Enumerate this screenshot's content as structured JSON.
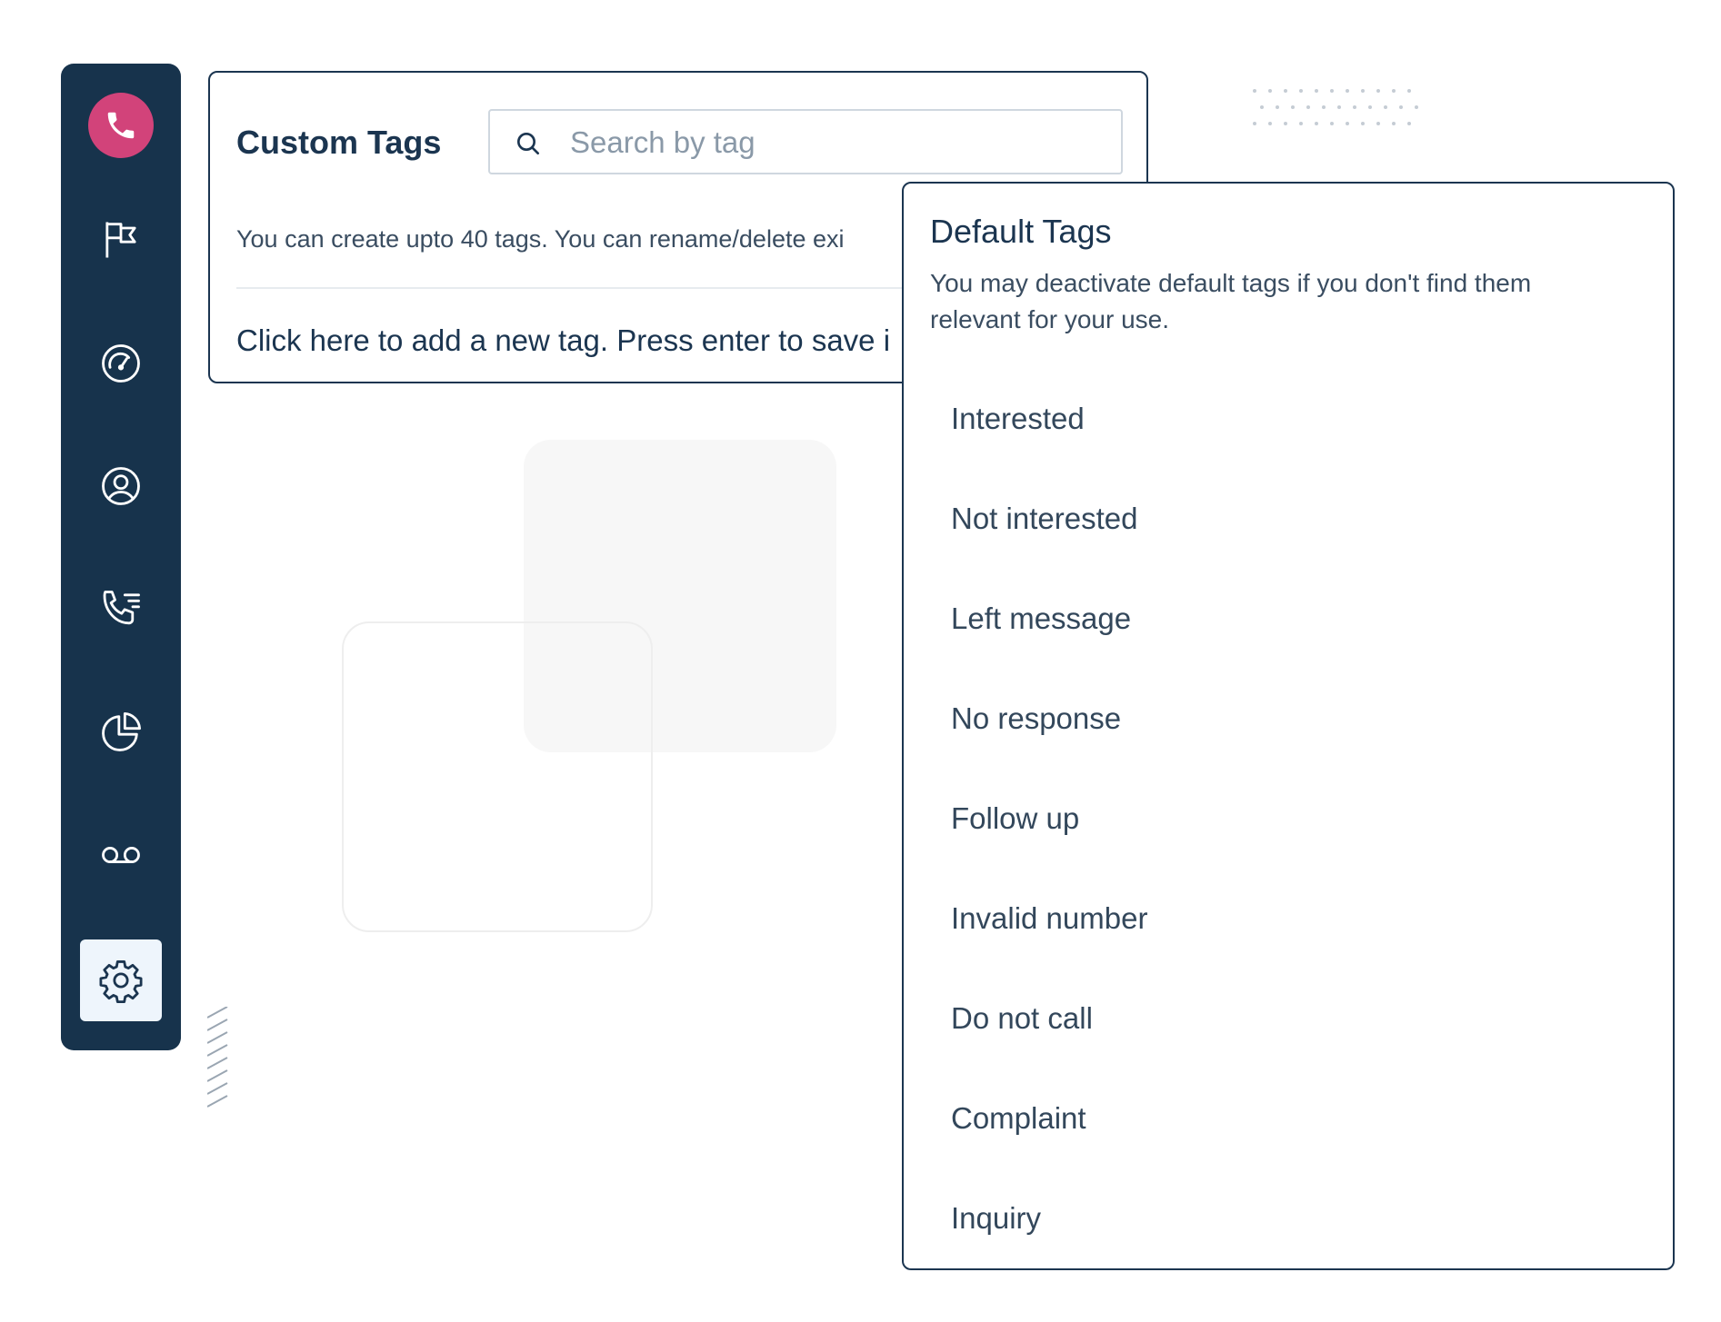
{
  "sidebar": {
    "logo_icon": "phone-icon",
    "logo_color": "#d2437a",
    "background_color": "#17334c",
    "items": [
      {
        "icon": "flag-icon"
      },
      {
        "icon": "gauge-icon"
      },
      {
        "icon": "user-circle-icon"
      },
      {
        "icon": "call-list-icon"
      },
      {
        "icon": "pie-chart-icon"
      },
      {
        "icon": "voicemail-icon"
      },
      {
        "icon": "gear-icon",
        "active": true
      }
    ]
  },
  "custom_tags": {
    "title": "Custom Tags",
    "search_placeholder": "Search by tag",
    "search_value": "",
    "description": "You can create upto 40 tags. You can rename/delete exi",
    "add_prompt": "Click here to add a new tag. Press enter to save i"
  },
  "default_tags": {
    "title": "Default Tags",
    "description": "You may deactivate default tags if you don't find them relevant for your use.",
    "tags": [
      "Interested",
      "Not interested",
      "Left message",
      "No response",
      "Follow up",
      "Invalid number",
      "Do not call",
      "Complaint",
      "Inquiry"
    ]
  },
  "colors": {
    "text_primary": "#1b3550",
    "border_dark": "#1b3550",
    "active_nav_bg": "#eef5fc"
  }
}
